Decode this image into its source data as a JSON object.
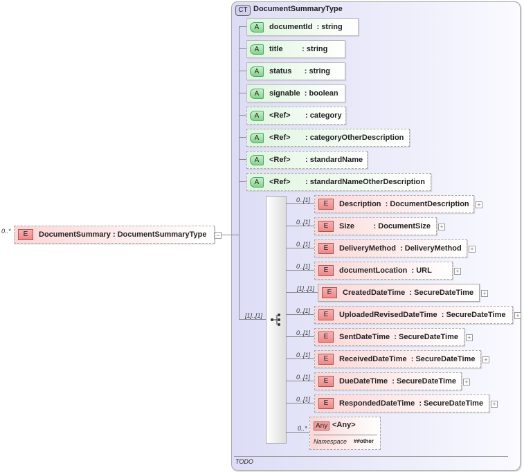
{
  "root": {
    "multiplicity": "0..*",
    "badge": "E",
    "name": "DocumentSummary",
    "type": ": DocumentSummaryType",
    "collapse": "−"
  },
  "complex_type": {
    "badge": "CT",
    "name": "DocumentSummaryType",
    "annotation": "TODO"
  },
  "attributes": [
    {
      "badge": "A",
      "name": "documentId",
      "type": ": string",
      "ref": false
    },
    {
      "badge": "A",
      "name": "title       ",
      "type": ": string",
      "ref": false
    },
    {
      "badge": "A",
      "name": "status    ",
      "type": ": string",
      "ref": false
    },
    {
      "badge": "A",
      "name": "signable",
      "type": ": boolean",
      "ref": false
    },
    {
      "badge": "A",
      "name": "<Ref>     ",
      "type": ": category",
      "ref": true
    },
    {
      "badge": "A",
      "name": "<Ref>     ",
      "type": ": categoryOtherDescription",
      "ref": true
    },
    {
      "badge": "A",
      "name": "<Ref>     ",
      "type": ": standardName",
      "ref": true
    },
    {
      "badge": "A",
      "name": "<Ref>     ",
      "type": ": standardNameOtherDescription",
      "ref": true
    }
  ],
  "sequence": {
    "multiplicity": "[1]..[1]"
  },
  "elements": [
    {
      "mult": "0..[1]",
      "badge": "E",
      "name": "Description",
      "type": ": DocumentDescription",
      "required": false
    },
    {
      "mult": "0..[1]",
      "badge": "E",
      "name": "Size       ",
      "type": ": DocumentSize",
      "required": false
    },
    {
      "mult": "0..[1]",
      "badge": "E",
      "name": "DeliveryMethod",
      "type": ": DeliveryMethod",
      "required": false
    },
    {
      "mult": "0..[1]",
      "badge": "E",
      "name": "documentLocation",
      "type": ": URL",
      "required": false
    },
    {
      "mult": "[1]..[1]",
      "badge": "E",
      "name": "CreatedDateTime",
      "type": ": SecureDateTime",
      "required": true
    },
    {
      "mult": "0..[1]",
      "badge": "E",
      "name": "UploadedRevisedDateTime",
      "type": ": SecureDateTime",
      "required": false
    },
    {
      "mult": "0..[1]",
      "badge": "E",
      "name": "SentDateTime",
      "type": ": SecureDateTime",
      "required": false
    },
    {
      "mult": "0..[1]",
      "badge": "E",
      "name": "ReceivedDateTime",
      "type": ": SecureDateTime",
      "required": false
    },
    {
      "mult": "0..[1]",
      "badge": "E",
      "name": "DueDateTime",
      "type": ": SecureDateTime",
      "required": false
    },
    {
      "mult": "0..[1]",
      "badge": "E",
      "name": "RespondedDateTime",
      "type": ": SecureDateTime",
      "required": false
    }
  ],
  "any": {
    "mult": "0..*",
    "badge": "Any",
    "name": "<Any>",
    "ns_label": "Namespace",
    "ns_value": "##other"
  },
  "plus_symbol": "+"
}
